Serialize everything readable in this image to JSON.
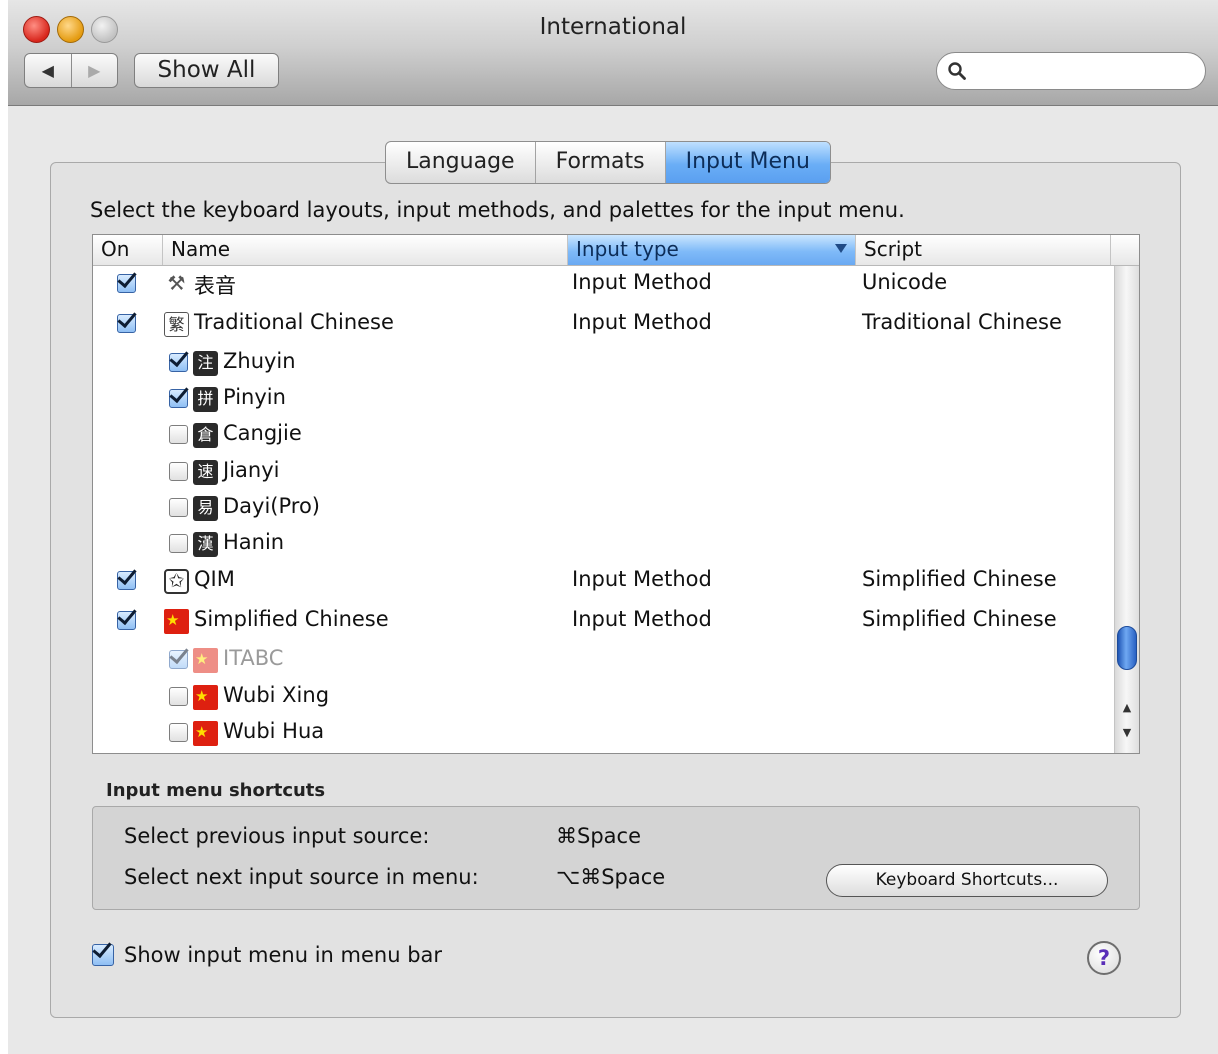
{
  "window": {
    "title": "International"
  },
  "toolbar": {
    "back_label": "◀",
    "forward_label": "▶",
    "show_all_label": "Show All",
    "search_placeholder": ""
  },
  "tabs": [
    {
      "label": "Language"
    },
    {
      "label": "Formats"
    },
    {
      "label": "Input Menu",
      "active": true
    }
  ],
  "instructions": "Select the keyboard layouts, input methods, and palettes for the input menu.",
  "table": {
    "columns": [
      {
        "label": "On"
      },
      {
        "label": "Name"
      },
      {
        "label": "Input type",
        "sorted": true
      },
      {
        "label": "Script"
      }
    ],
    "rows": [
      {
        "name": "表音",
        "icon": "tools-icon",
        "checked": true,
        "indent": 0,
        "input_type": "Input Method",
        "script": "Unicode"
      },
      {
        "name": "Traditional Chinese",
        "icon": "traditional-chinese-icon",
        "icon_text": "繁",
        "checked": true,
        "indent": 0,
        "input_type": "Input Method",
        "script": "Traditional Chinese"
      },
      {
        "name": "Zhuyin",
        "icon": "zhuyin-icon",
        "icon_text": "注",
        "checked": true,
        "indent": 1
      },
      {
        "name": "Pinyin",
        "icon": "pinyin-icon",
        "icon_text": "拼",
        "checked": true,
        "indent": 1
      },
      {
        "name": "Cangjie",
        "icon": "cangjie-icon",
        "icon_text": "倉",
        "checked": false,
        "indent": 1
      },
      {
        "name": "Jianyi",
        "icon": "jianyi-icon",
        "icon_text": "速",
        "checked": false,
        "indent": 1
      },
      {
        "name": "Dayi(Pro)",
        "icon": "dayi-icon",
        "icon_text": "易",
        "checked": false,
        "indent": 1
      },
      {
        "name": "Hanin",
        "icon": "hanin-icon",
        "icon_text": "漢",
        "checked": false,
        "indent": 1
      },
      {
        "name": "QIM",
        "icon": "qim-icon",
        "icon_text": "✩",
        "checked": true,
        "indent": 0,
        "input_type": "Input Method",
        "script": "Simplified Chinese"
      },
      {
        "name": "Simplified Chinese",
        "icon": "china-flag-icon",
        "checked": true,
        "indent": 0,
        "input_type": "Input Method",
        "script": "Simplified Chinese"
      },
      {
        "name": "ITABC",
        "icon": "itabc-icon",
        "checked": true,
        "disabled": true,
        "indent": 1
      },
      {
        "name": "Wubi Xing",
        "icon": "wubi-xing-icon",
        "checked": false,
        "indent": 1
      },
      {
        "name": "Wubi Hua",
        "icon": "wubi-hua-icon",
        "checked": false,
        "indent": 1
      }
    ],
    "scroll_position": 0.78
  },
  "shortcuts": {
    "title": "Input menu shortcuts",
    "previous_label": "Select previous input source:",
    "previous_key": "⌘Space",
    "next_label": "Select next input source in menu:",
    "next_key": "⌥⌘Space",
    "keyboard_shortcuts_button": "Keyboard Shortcuts..."
  },
  "show_menu": {
    "label": "Show input menu in menu bar",
    "checked": true
  },
  "help": {
    "label": "?"
  }
}
